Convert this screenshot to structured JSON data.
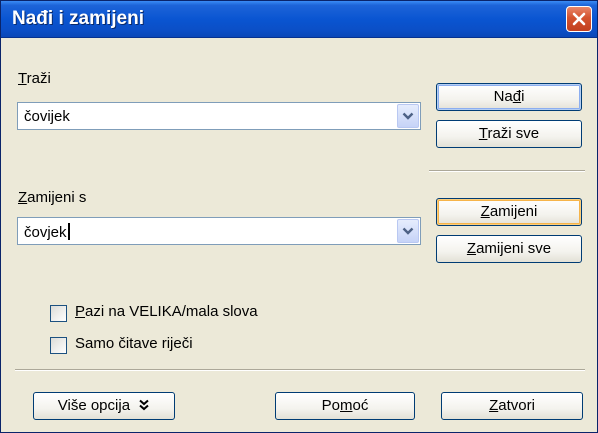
{
  "window": {
    "title": "Nađi i zamijeni"
  },
  "search": {
    "label_accel": "T",
    "label_rest": "raži",
    "value": "čovijek"
  },
  "replace": {
    "label_accel": "Z",
    "label_rest": "amijeni s",
    "value": "čovjek"
  },
  "buttons": {
    "find": {
      "pre": "Na",
      "accel": "đ",
      "post": "i"
    },
    "find_all": {
      "pre": "",
      "accel": "T",
      "post": "raži sve"
    },
    "replace": {
      "pre": "",
      "accel": "Z",
      "post": "amijeni"
    },
    "replace_all": {
      "pre": "",
      "accel": "Z",
      "post": "amijeni sve"
    },
    "more_options": {
      "label": "Više opcija",
      "icon": "double-chevron-down-icon"
    },
    "help": {
      "pre": "Po",
      "accel": "m",
      "post": "oć"
    },
    "close": {
      "pre": "",
      "accel": "Z",
      "post": "atvori"
    }
  },
  "options": {
    "match_case": {
      "pre": "",
      "accel": "P",
      "post": "azi na VELIKA/mala slova",
      "checked": false
    },
    "whole_words": {
      "label": "Samo čitave riječi",
      "checked": false
    }
  },
  "colors": {
    "titlebar": "#0a55d2",
    "dialog_bg": "#ece9d8",
    "close_button": "#d4532f"
  }
}
